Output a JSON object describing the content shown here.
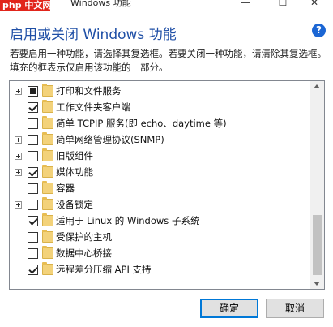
{
  "titlebar": {
    "watermark": "中文网",
    "title": "Windows 功能",
    "minimize": "—",
    "maximize": "☐",
    "close": "✕"
  },
  "dialog": {
    "heading": "启用或关闭 Windows 功能",
    "help": "?",
    "description": "若要启用一种功能，请选择其复选框。若要关闭一种功能，请清除其复选框。填充的框表示仅启用该功能的一部分。"
  },
  "features": [
    {
      "label": "打印和文件服务",
      "expandable": true,
      "state": "partial"
    },
    {
      "label": "工作文件夹客户端",
      "expandable": false,
      "state": "checked"
    },
    {
      "label": "简单 TCPIP 服务(即 echo、daytime 等)",
      "expandable": false,
      "state": "unchecked"
    },
    {
      "label": "简单网络管理协议(SNMP)",
      "expandable": true,
      "state": "unchecked"
    },
    {
      "label": "旧版组件",
      "expandable": true,
      "state": "unchecked"
    },
    {
      "label": "媒体功能",
      "expandable": true,
      "state": "checked"
    },
    {
      "label": "容器",
      "expandable": false,
      "state": "unchecked"
    },
    {
      "label": "设备锁定",
      "expandable": true,
      "state": "unchecked"
    },
    {
      "label": "适用于 Linux 的 Windows 子系统",
      "expandable": false,
      "state": "checked"
    },
    {
      "label": "受保护的主机",
      "expandable": false,
      "state": "unchecked"
    },
    {
      "label": "数据中心桥接",
      "expandable": false,
      "state": "unchecked"
    },
    {
      "label": "远程差分压缩 API 支持",
      "expandable": false,
      "state": "checked"
    }
  ],
  "buttons": {
    "ok": "确定",
    "cancel": "取消"
  }
}
